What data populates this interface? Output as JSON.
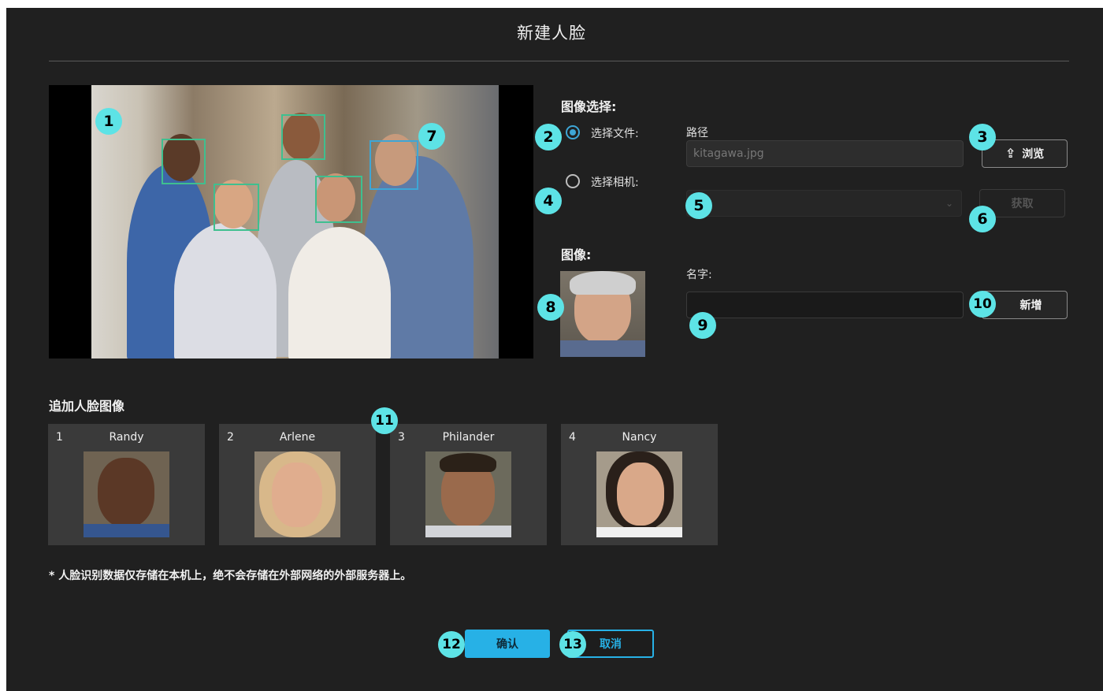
{
  "dialog": {
    "title": "新建人脸"
  },
  "image_select": {
    "heading": "图像选择:",
    "file_option": "选择文件:",
    "camera_option": "选择相机:",
    "path_label": "路径",
    "path_value": "kitagawa.jpg",
    "browse_label": "浏览",
    "capture_label": "获取"
  },
  "image_section": {
    "heading": "图像:"
  },
  "name": {
    "label": "名字:",
    "value": "",
    "add_label": "新增"
  },
  "faces": {
    "heading": "追加人脸图像",
    "items": [
      {
        "index": "1",
        "name": "Randy"
      },
      {
        "index": "2",
        "name": "Arlene"
      },
      {
        "index": "3",
        "name": "Philander"
      },
      {
        "index": "4",
        "name": "Nancy"
      }
    ]
  },
  "note": "* 人脸识别数据仅存储在本机上，绝不会存储在外部网络的外部服务器上。",
  "footer": {
    "confirm": "确认",
    "cancel": "取消"
  },
  "callouts": [
    "1",
    "2",
    "3",
    "4",
    "5",
    "6",
    "7",
    "8",
    "9",
    "10",
    "11",
    "12",
    "13"
  ],
  "colors": {
    "accent": "#27b1e6",
    "callout": "#5de3e6",
    "face_box": "#3fbf8f",
    "selected_box": "#3ea6d6",
    "background": "#202020"
  },
  "icons": {
    "browse": "upload-icon",
    "select": "chevron-down-icon"
  }
}
